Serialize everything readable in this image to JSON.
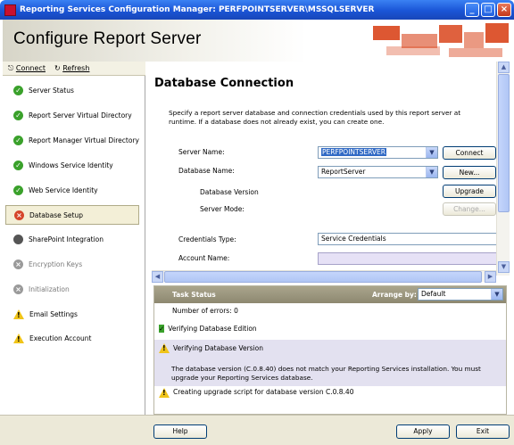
{
  "window": {
    "title": "Reporting Services Configuration Manager: PERFPOINTSERVER\\MSSQLSERVER"
  },
  "header": {
    "title": "Configure Report Server"
  },
  "toolbar": {
    "connect_label": "Connect",
    "refresh_label": "Refresh"
  },
  "sidebar": {
    "items": [
      {
        "label": "Server Status",
        "status": "ok"
      },
      {
        "label": "Report Server Virtual Directory",
        "status": "ok"
      },
      {
        "label": "Report Manager Virtual Directory",
        "status": "ok"
      },
      {
        "label": "Windows Service Identity",
        "status": "ok"
      },
      {
        "label": "Web Service Identity",
        "status": "ok"
      },
      {
        "label": "Database Setup",
        "status": "error"
      },
      {
        "label": "SharePoint Integration",
        "status": "neutral"
      },
      {
        "label": "Encryption Keys",
        "status": "disabled"
      },
      {
        "label": "Initialization",
        "status": "disabled"
      },
      {
        "label": "Email Settings",
        "status": "warning"
      },
      {
        "label": "Execution Account",
        "status": "warning"
      }
    ]
  },
  "main": {
    "title": "Database Connection",
    "description": "Specify a report server database and connection credentials used by this report server at runtime. If a database does not already exist, you can create one.",
    "server_name_label": "Server Name:",
    "server_name_value": "PERFPOINTSERVER",
    "database_name_label": "Database Name:",
    "database_name_value": "ReportServer",
    "database_version_label": "Database Version",
    "server_mode_label": "Server Mode:",
    "credentials_type_label": "Credentials Type:",
    "credentials_type_value": "Service Credentials",
    "account_name_label": "Account Name:",
    "account_name_value": "",
    "connect_button": "Connect",
    "new_button": "New...",
    "upgrade_button": "Upgrade",
    "change_button": "Change..."
  },
  "task_status": {
    "title": "Task Status",
    "arrange_by_label": "Arrange by:",
    "arrange_by_value": "Default",
    "errors_text": "Number of errors: 0",
    "row1": "Verifying Database Edition",
    "row2": "Verifying Database Version",
    "row2_detail": "The database version (C.0.8.40) does not match your Reporting Services installation. You must upgrade your Reporting Services database.",
    "row3": "Creating upgrade script for database version C.0.8.40"
  },
  "footer": {
    "help_button": "Help",
    "apply_button": "Apply",
    "exit_button": "Exit"
  },
  "icons": {
    "ok": "check-circle-icon",
    "error": "x-circle-icon",
    "warning": "warning-triangle-icon",
    "disabled": "gray-circle-icon",
    "neutral": "dark-circle-icon"
  },
  "colors": {
    "titlebar": "#1a55d6",
    "accent": "#d9451c",
    "ok": "#3aa12b",
    "error": "#d5452b",
    "warning": "#f0c419"
  }
}
